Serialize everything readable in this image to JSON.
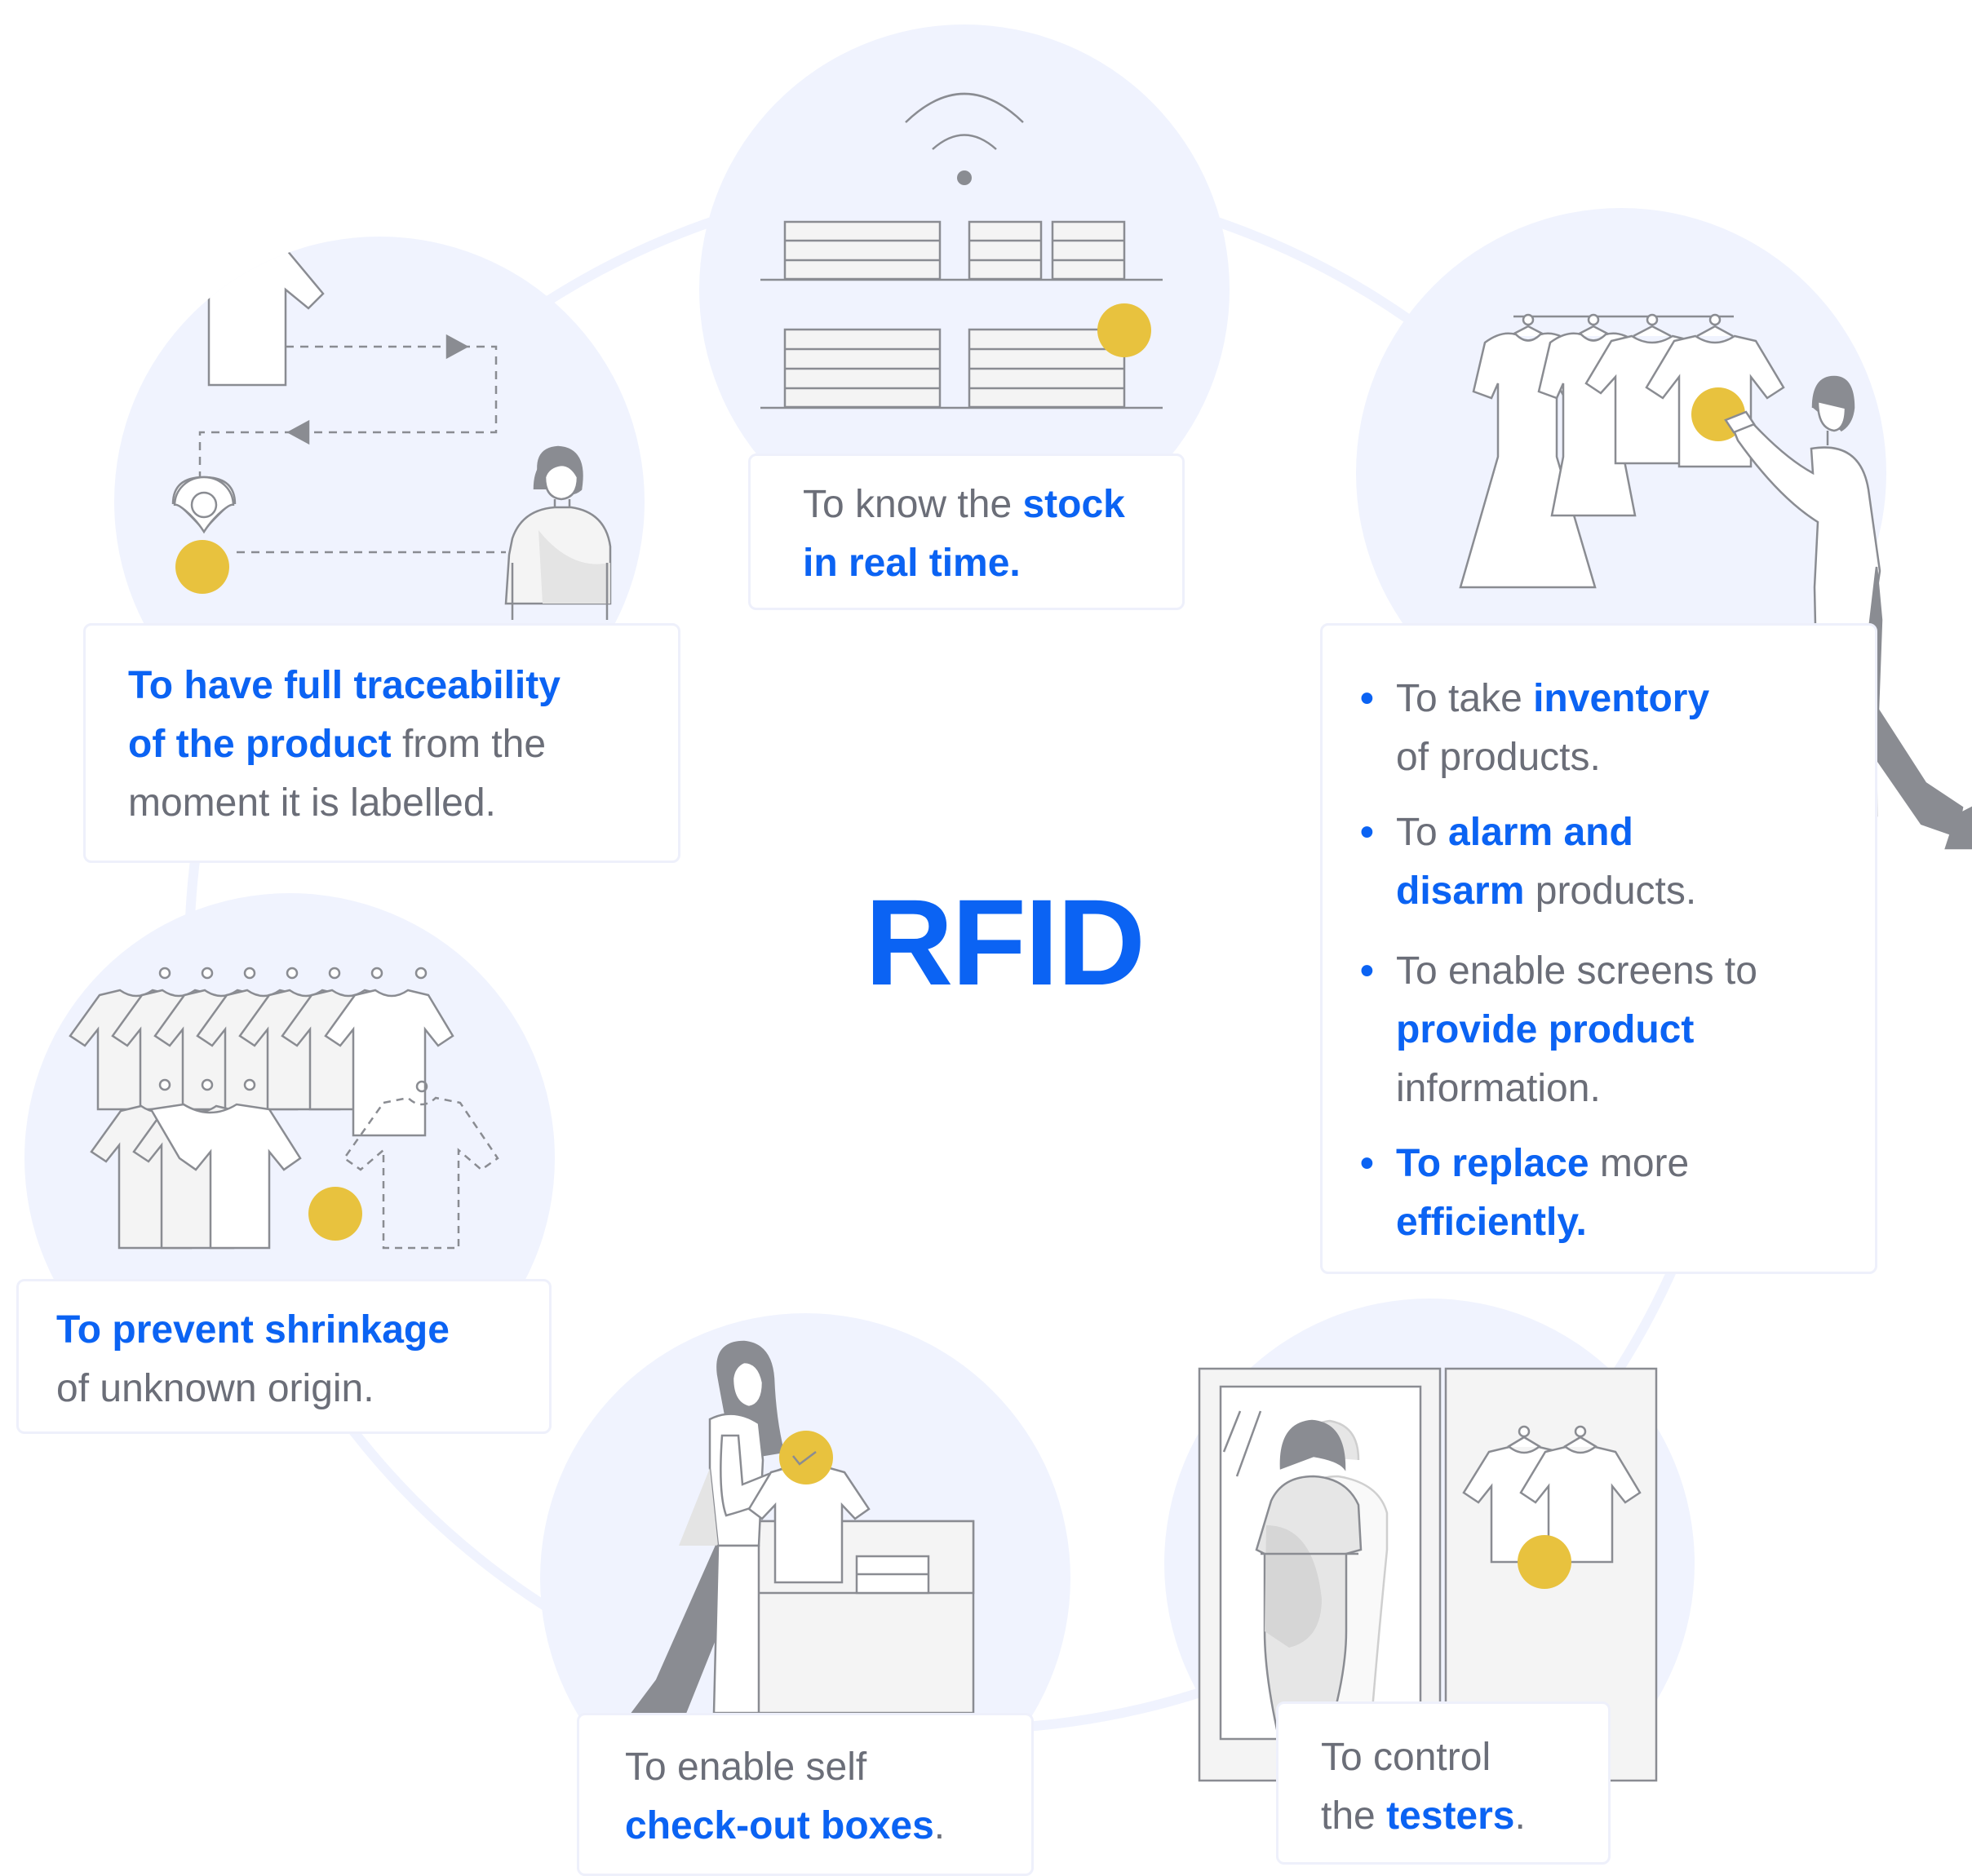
{
  "title": "RFID",
  "colors": {
    "accent": "#0b63f3",
    "text": "#6b6e78",
    "circle": "#f0f3fe",
    "tag": "#e8c23e",
    "illustration_stroke": "#8a8c92"
  },
  "cards": {
    "stock": {
      "l1_pre": "To know the ",
      "l1_bold": "stock",
      "l2_bold": "in real time."
    },
    "trace": {
      "l1_bold": "To have full traceability",
      "l2_bold": "of the product",
      "l2_post": " from the",
      "l3": "moment it is labelled."
    },
    "shrink": {
      "l1_bold": "To prevent shrinkage",
      "l2": "of unknown origin."
    },
    "checkout": {
      "l1": "To enable self",
      "l2_bold": "check-out boxes",
      "l2_post": "."
    },
    "testers": {
      "l1": "To control",
      "l2_pre": "the ",
      "l2_bold": "testers",
      "l2_post": "."
    },
    "list": {
      "item1": {
        "l1_pre": "To take ",
        "l1_bold": "inventory",
        "l2": "of products."
      },
      "item2": {
        "l1_pre": "To ",
        "l1_bold": "alarm and",
        "l2_bold": "disarm",
        "l2_post": " products."
      },
      "item3": {
        "l1": "To enable screens to",
        "l2_bold": "provide product",
        "l3": "information."
      },
      "item4": {
        "l1_bold": "To replace",
        "l1_post": " more",
        "l2_bold": "efficiently."
      }
    }
  }
}
